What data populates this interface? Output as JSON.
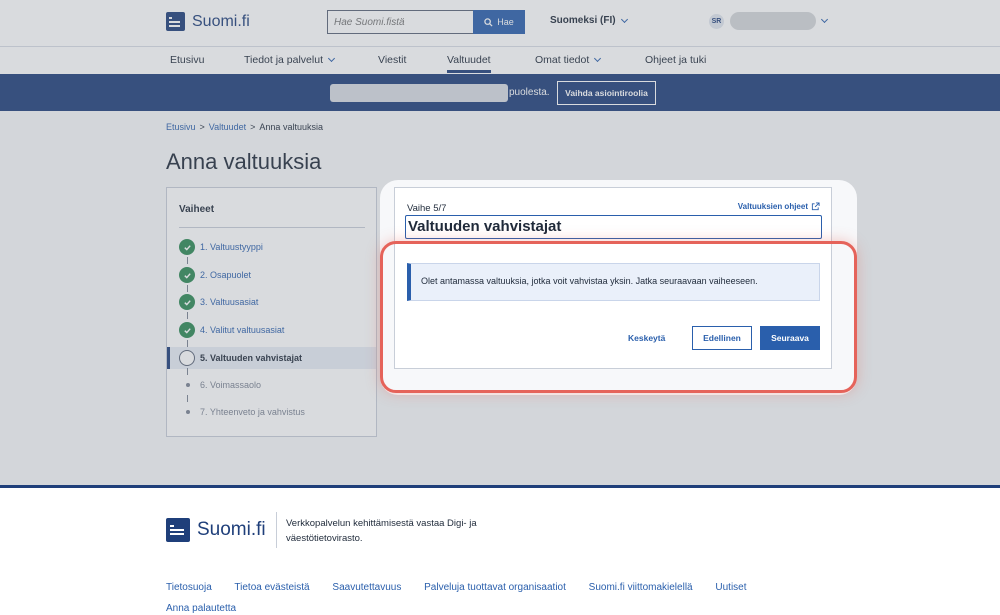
{
  "header": {
    "logo_text": "Suomi.fi",
    "search_placeholder": "Hae Suomi.fistä",
    "search_button": "Hae",
    "language": "Suomeksi (FI)",
    "user_initials": "SR"
  },
  "nav": {
    "items": [
      "Etusivu",
      "Tiedot ja palvelut",
      "Viestit",
      "Valtuudet",
      "Omat tiedot",
      "Ohjeet ja tuki"
    ],
    "active": "Valtuudet"
  },
  "rolebar": {
    "suffix": "puolesta.",
    "switch_button": "Vaihda asiointiroolia"
  },
  "breadcrumb": [
    "Etusivu",
    "Valtuudet",
    "Anna valtuuksia"
  ],
  "page_title": "Anna valtuuksia",
  "steps": {
    "heading": "Vaiheet",
    "items": [
      "1. Valtuustyyppi",
      "2. Osapuolet",
      "3. Valtuusasiat",
      "4. Valitut valtuusasiat",
      "5. Valtuuden vahvistajat",
      "6. Voimassaolo",
      "7. Yhteenveto ja vahvistus"
    ],
    "current_index": 5
  },
  "main": {
    "phase": "Vaihe 5/7",
    "help_link": "Valtuuksien ohjeet",
    "heading": "Valtuuden vahvistajat",
    "notice": "Olet antamassa valtuuksia, jotka voit vahvistaa yksin. Jatka seuraavaan vaiheeseen.",
    "cancel": "Keskeytä",
    "previous": "Edellinen",
    "next": "Seuraava"
  },
  "footer": {
    "logo_text": "Suomi.fi",
    "description": "Verkkopalvelun kehittämisestä vastaa Digi- ja väestötietovirasto.",
    "links": [
      "Tietosuoja",
      "Tietoa evästeistä",
      "Saavutettavuus",
      "Palveluja tuottavat organisaatiot",
      "Suomi.fi viittomakielellä",
      "Uutiset",
      "Anna palautetta"
    ]
  },
  "colors": {
    "brand": "#1f3f7a",
    "accent": "#2a5fac",
    "success": "#2e8a55",
    "highlight": "#e5635a"
  }
}
